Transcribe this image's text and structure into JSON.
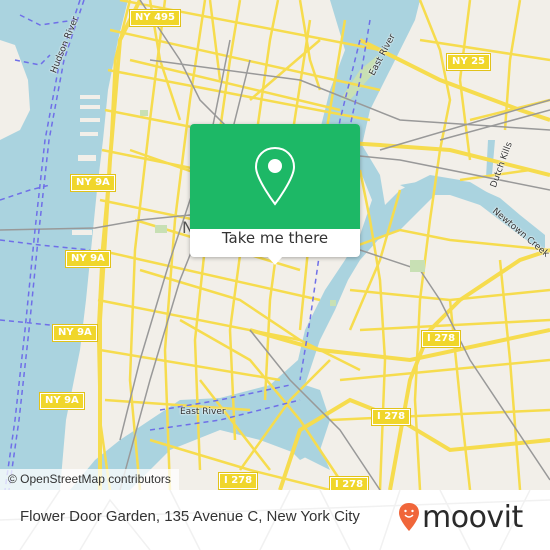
{
  "map": {
    "attribution": "© OpenStreetMap contributors",
    "shields": [
      {
        "label": "NY 495"
      },
      {
        "label": "NY 25"
      },
      {
        "label": "NY 9A"
      },
      {
        "label": "NY 9A"
      },
      {
        "label": "NY 9A"
      },
      {
        "label": "NY 9A"
      },
      {
        "label": "I 278"
      },
      {
        "label": "I 278"
      },
      {
        "label": "I 278"
      },
      {
        "label": "I 278"
      }
    ],
    "water_labels": [
      {
        "label": "Hudson River"
      },
      {
        "label": "East River"
      },
      {
        "label": "East River"
      },
      {
        "label": "Dutch Kills"
      },
      {
        "label": "Newtown Creek"
      }
    ],
    "partial_label": "N",
    "colors": {
      "land": "#f2efe9",
      "water": "#aad3df",
      "road": "#f6dc4e",
      "ferry": "#6f6fe8",
      "rail": "#999999"
    }
  },
  "popup": {
    "icon": "map-pin-icon",
    "cta_label": "Take me there",
    "color": "#1db866"
  },
  "footer": {
    "address": "Flower Door Garden, 135 Avenue C, New York City",
    "brand": "moovit",
    "brand_color": "#f0663a"
  }
}
